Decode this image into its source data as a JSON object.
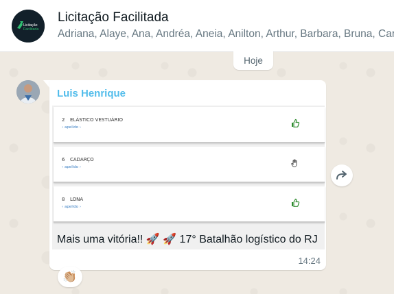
{
  "header": {
    "title": "Licitação Facilitada",
    "participants": "Adriana, Alaye, Ana, Andréa, Aneia, Anilton, Arthur, Barbara, Bruna, Car...",
    "avatar_logo_line1": "Licitação",
    "avatar_logo_line2": "Facilitada"
  },
  "date_chip": "Hoje",
  "message": {
    "sender": "Luis Henrique",
    "items": [
      {
        "number": "2",
        "name": "ELÁSTICO VESTUÁRIO",
        "status": "‹ apelido ›",
        "icon": "thumbs-up-icon"
      },
      {
        "number": "6",
        "name": "CADARÇO",
        "status": "‹ apelido ›",
        "icon": "hand-icon"
      },
      {
        "number": "8",
        "name": "LONA",
        "status": "‹ apelido ›",
        "icon": "thumbs-up-icon"
      }
    ],
    "text": "Mais uma vitória!! 🚀 🚀 17° Batalhão logístico do RJ",
    "time": "14:24",
    "reaction": "👏🏼"
  },
  "colors": {
    "sender_name": "#53bdeb",
    "chat_background": "#efeae2",
    "thumbs_up": "#2e8b2e"
  }
}
